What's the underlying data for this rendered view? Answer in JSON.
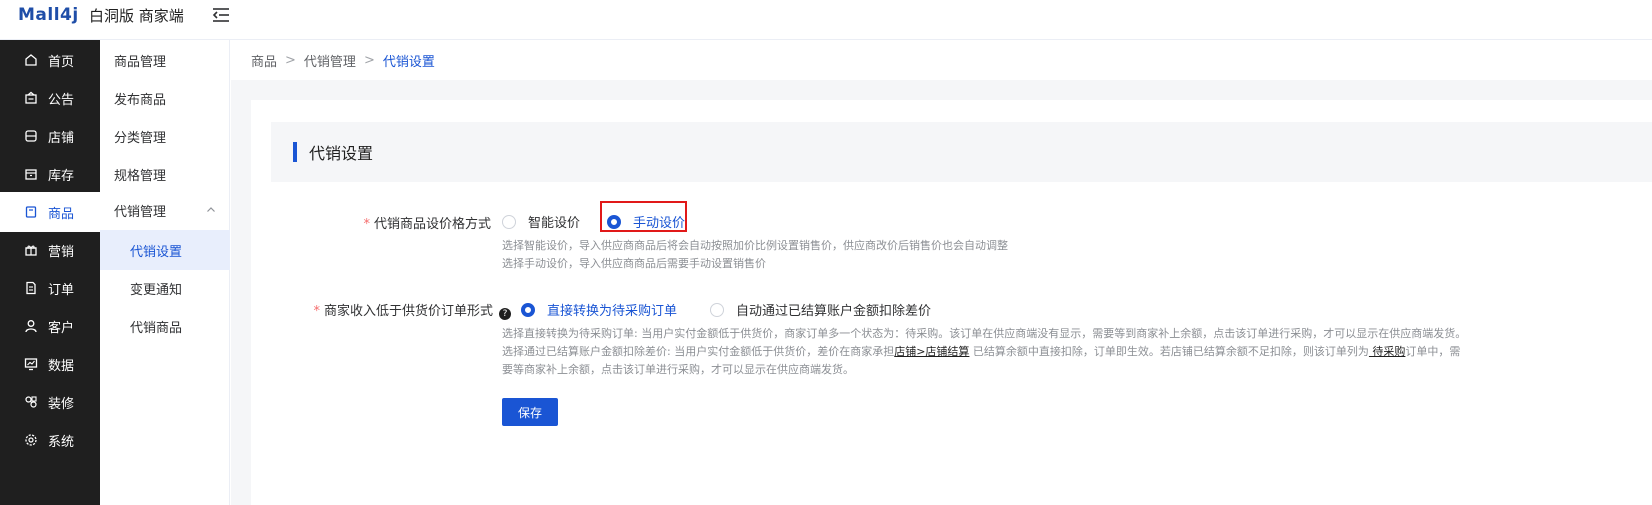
{
  "header": {
    "logo": "Mall4j",
    "title": "白洞版 商家端"
  },
  "sidebar": {
    "items": [
      {
        "label": "首页",
        "icon": "home-icon"
      },
      {
        "label": "公告",
        "icon": "notice-icon"
      },
      {
        "label": "店铺",
        "icon": "shop-icon"
      },
      {
        "label": "库存",
        "icon": "inventory-icon"
      },
      {
        "label": "商品",
        "icon": "goods-icon"
      },
      {
        "label": "营销",
        "icon": "marketing-icon"
      },
      {
        "label": "订单",
        "icon": "order-icon"
      },
      {
        "label": "客户",
        "icon": "customer-icon"
      },
      {
        "label": "数据",
        "icon": "data-icon"
      },
      {
        "label": "装修",
        "icon": "decorate-icon"
      },
      {
        "label": "系统",
        "icon": "system-icon"
      }
    ],
    "active": "商品"
  },
  "subsidebar": {
    "items": [
      {
        "label": "商品管理"
      },
      {
        "label": "发布商品"
      },
      {
        "label": "分类管理"
      },
      {
        "label": "规格管理"
      },
      {
        "label": "代销管理"
      },
      {
        "label": "代销设置"
      },
      {
        "label": "变更通知"
      },
      {
        "label": "代销商品"
      }
    ],
    "active": "代销设置"
  },
  "breadcrumb": {
    "items": [
      "商品",
      "代销管理",
      "代销设置"
    ]
  },
  "section": {
    "title": "代销设置"
  },
  "form": {
    "pricing": {
      "label": "代销商品设价格方式",
      "required": "*",
      "options": [
        "智能设价",
        "手动设价"
      ],
      "selected": "手动设价",
      "hint1": "选择智能设价，导入供应商商品后将会自动按照加价比例设置销售价，供应商改价后销售价也会自动调整",
      "hint2": "选择手动设价，导入供应商商品后需要手动设置销售价"
    },
    "income": {
      "label": "商家收入低于供货价订单形式",
      "required": "*",
      "help": "?",
      "options": [
        "直接转换为待采购订单",
        "自动通过已结算账户金额扣除差价"
      ],
      "selected": "直接转换为待采购订单",
      "hint1": "选择直接转换为待采购订单: 当用户实付金额低于供货价，商家订单多一个状态为：待采购。该订单在供应商端没有显示，需要等到商家补上余额，点击该订单进行采购，才可以显示在供应商端发货。",
      "hint2_a": "选择通过已结算账户金额扣除差价: 当用户实付金额低于供货价，差价在商家承担",
      "hint2_link1": "店铺>店铺结算",
      "hint2_b": " 已结算余额中直接扣除，订单即生效。若店铺已结算余额不足扣除，则该订单列为",
      "hint2_link2": " 待采购",
      "hint2_c": "订单中，需",
      "hint3": "要等商家补上余额，点击该订单进行采购，才可以显示在供应商端发货。"
    },
    "save_label": "保存"
  },
  "colors": {
    "primary": "#1a55d4",
    "sidebar_bg": "#1f1f1f",
    "highlight_box": "#e11919",
    "required": "#f56c6c"
  }
}
